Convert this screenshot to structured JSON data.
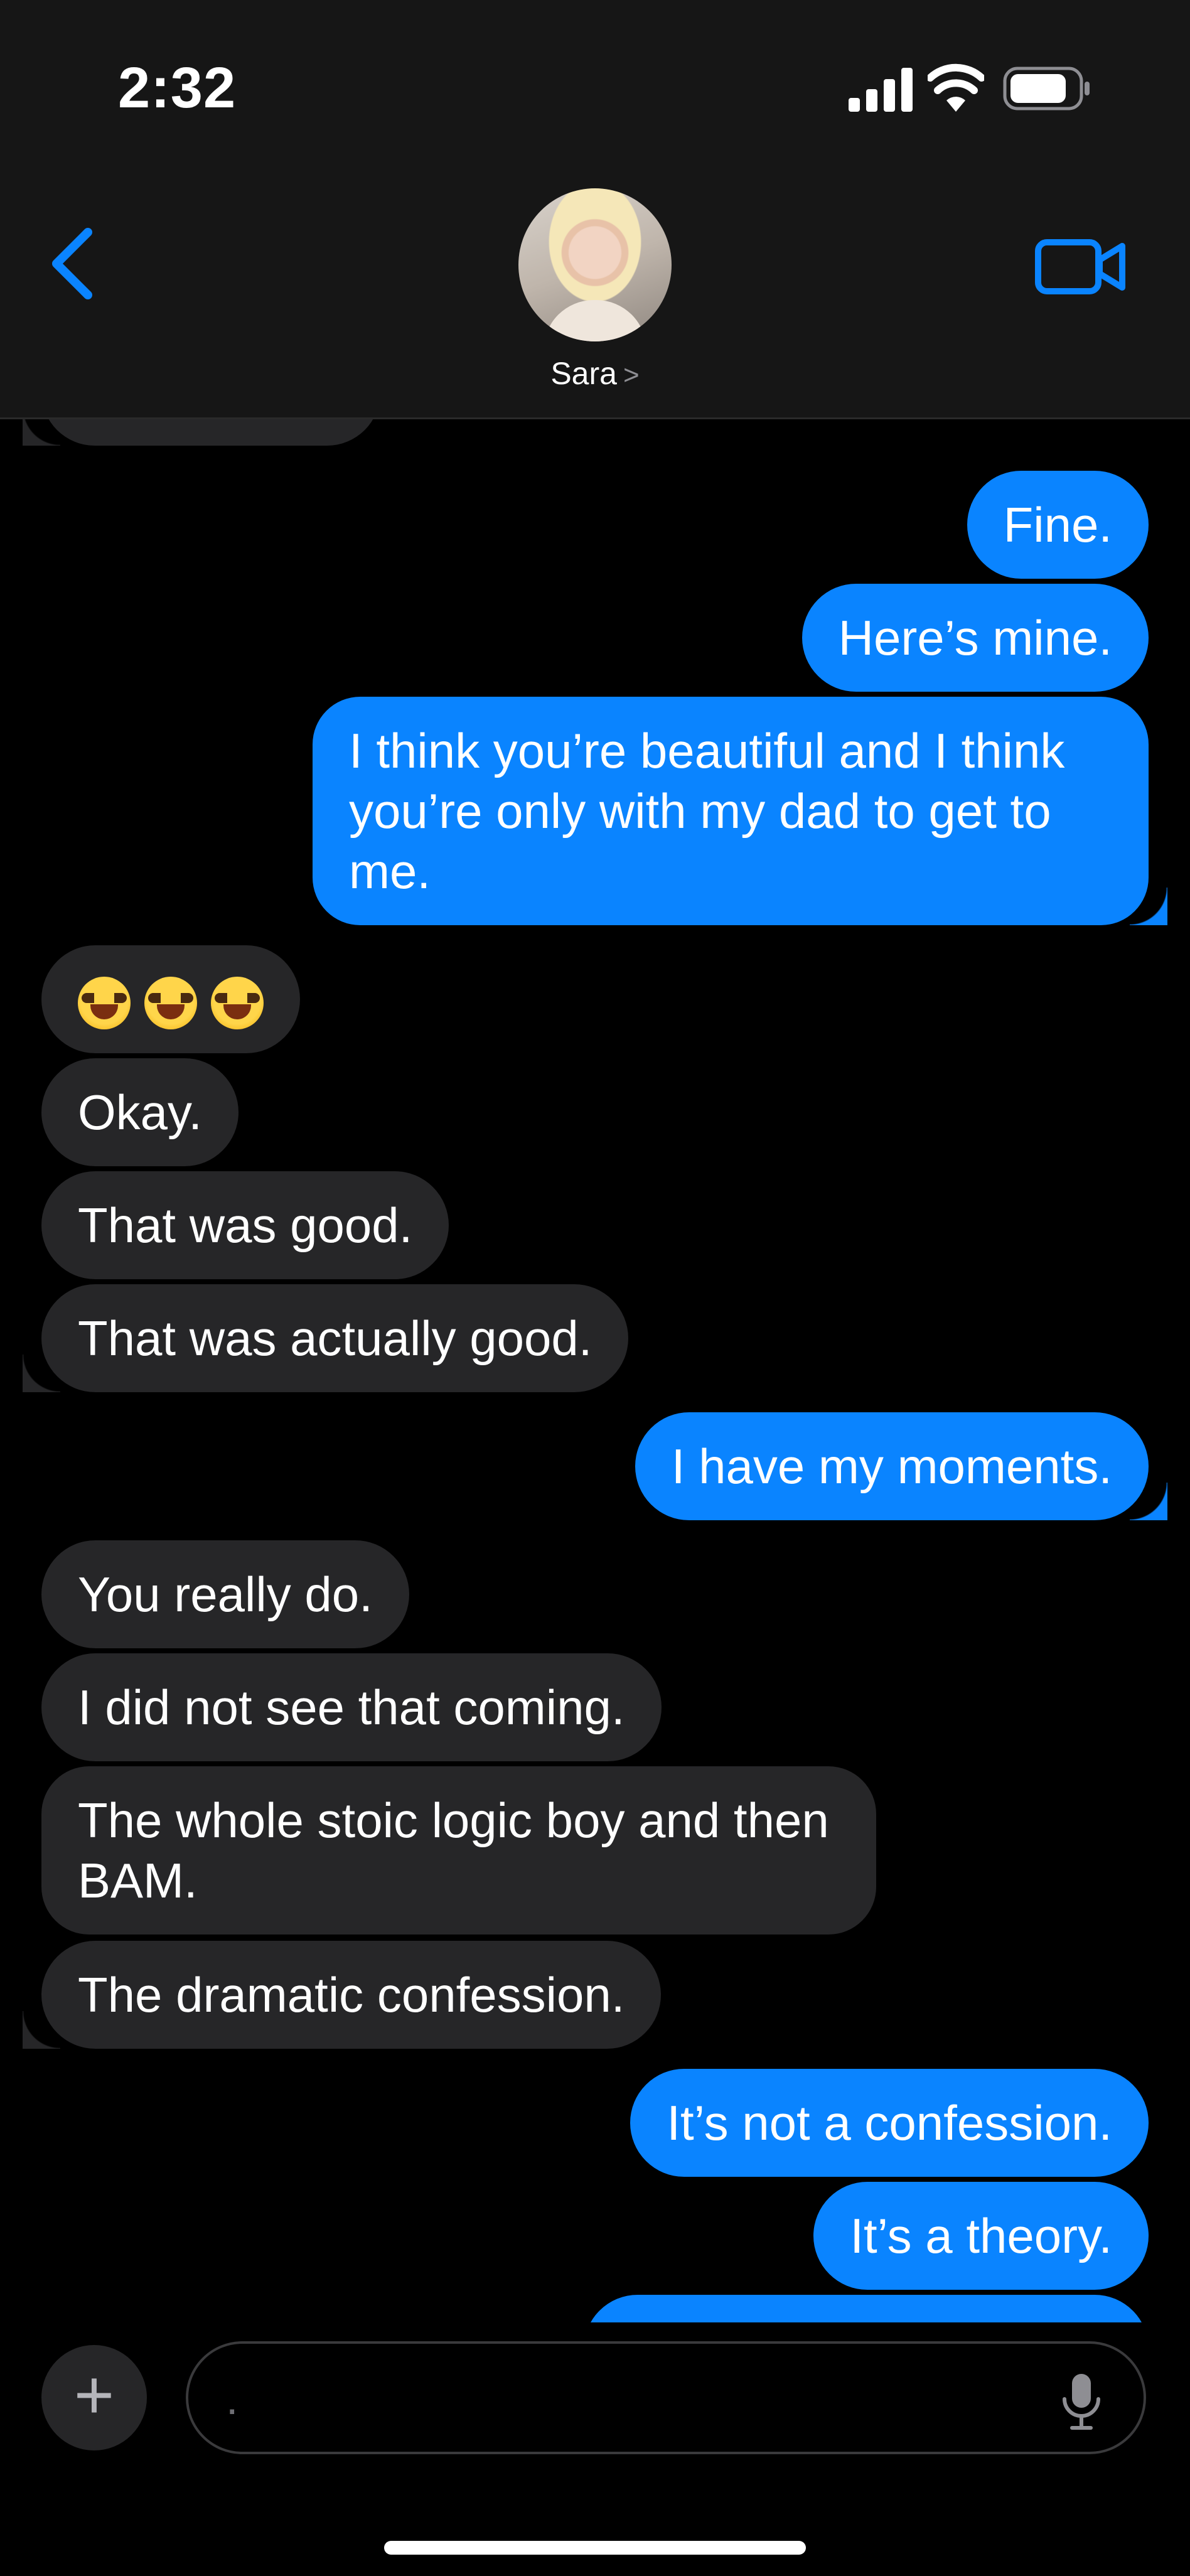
{
  "status_bar": {
    "time": "2:32"
  },
  "header": {
    "contact_name": "Sara",
    "name_chevron": ">"
  },
  "messages": [
    {
      "direction": "in",
      "text": ""
    },
    {
      "direction": "out",
      "text": "Fine."
    },
    {
      "direction": "out",
      "text": "Here’s mine."
    },
    {
      "direction": "out",
      "text": "I think you’re beautiful and I think you’re only with my dad to get to me."
    },
    {
      "direction": "in",
      "text": "😂😂😂"
    },
    {
      "direction": "in",
      "text": "Okay."
    },
    {
      "direction": "in",
      "text": "That was good."
    },
    {
      "direction": "in",
      "text": "That was actually good."
    },
    {
      "direction": "out",
      "text": "I have my moments."
    },
    {
      "direction": "in",
      "text": "You really do."
    },
    {
      "direction": "in",
      "text": "I did not see that coming."
    },
    {
      "direction": "in",
      "text": "The whole stoic logic boy and then BAM."
    },
    {
      "direction": "in",
      "text": "The dramatic confession."
    },
    {
      "direction": "out",
      "text": "It’s not a confession."
    },
    {
      "direction": "out",
      "text": "It’s a theory."
    },
    {
      "direction": "out",
      "text": ""
    }
  ],
  "composer": {
    "plus_label": "+",
    "placeholder": "."
  },
  "icons": {
    "back": "chevron-left-icon",
    "video": "video-camera-icon",
    "mic": "microphone-icon",
    "signal": "cellular-signal-icon",
    "wifi": "wifi-icon",
    "battery": "battery-icon"
  },
  "colors": {
    "accent": "#0a84ff",
    "incoming_bubble": "#262628",
    "header_bg": "#161616"
  }
}
